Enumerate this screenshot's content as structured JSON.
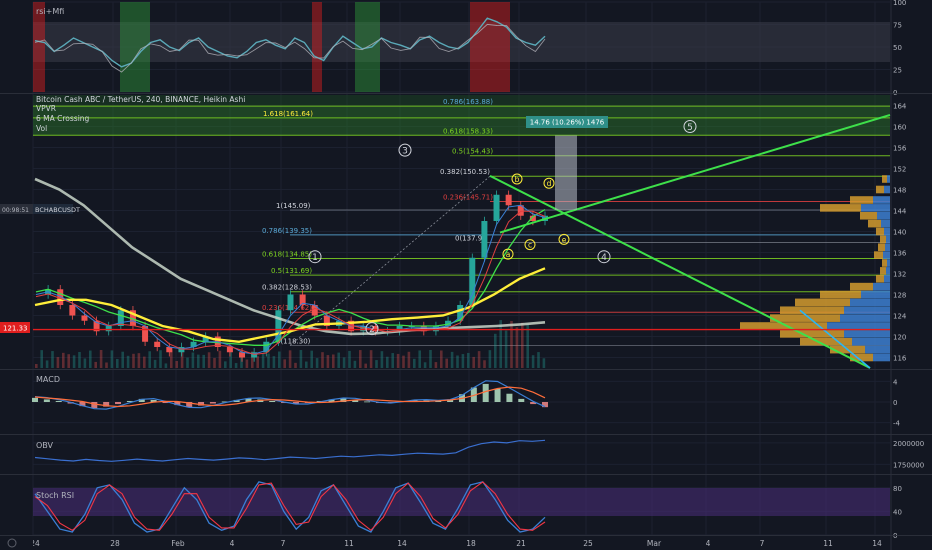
{
  "colors": {
    "bg": "#131722",
    "up": "#26a69a",
    "down": "#ef5350",
    "grid": "#1e2330",
    "axis_text": "#b2b5be",
    "yellow": "#ffee3a",
    "bright_green": "#3ee04a",
    "fib_green": "#7ed321",
    "ma_gray": "#c9d6c9",
    "macd_blue": "#3a7fd5",
    "macd_orange": "#ff6d3a",
    "stoch_purple": "#4a2d7a",
    "vpvr_orange": "#d39b2e",
    "vpvr_blue": "#3d7fd0",
    "price_red": "#e01e1e"
  },
  "panes": {
    "rsi": {
      "title": "rsi+Mfi",
      "ticks": [
        "100",
        "75",
        "50",
        "25",
        "0"
      ]
    },
    "main": {
      "title": "Bitcoin Cash ABC / TetherUS, 240, BINANCE, Heikin Ashi",
      "indicators": [
        "VPVR",
        "6 MA Crossing",
        "Vol"
      ],
      "ticks": [
        "164.00",
        "160.00",
        "156.00",
        "152.00",
        "148.00",
        "144.00",
        "140.00",
        "136.00",
        "132.00",
        "128.00",
        "124.00",
        "120.00",
        "116.00"
      ],
      "symbol_tag": "BCHABCUSDT",
      "current_price": "121.33",
      "small_price_tag": "00:98:51",
      "measure_label": "14.76 (10.26%) 1476"
    },
    "macd": {
      "title": "MACD",
      "ticks": [
        "4.0000",
        "0.0000",
        "-4.0000"
      ]
    },
    "obv": {
      "title": "OBV",
      "ticks": [
        "2000000.0000",
        "1750000.0000"
      ]
    },
    "stoch": {
      "title": "Stoch RSI",
      "ticks": [
        "80.0000",
        "40.0000",
        "0.0000"
      ]
    }
  },
  "time_axis": {
    "ticks": [
      "24",
      "28",
      "Feb",
      "4",
      "7",
      "11",
      "14",
      "18",
      "21",
      "25",
      "Mar",
      "4",
      "7",
      "11",
      "14"
    ]
  },
  "fib_levels": [
    {
      "label": "0.786(163.88)",
      "value": 163.88
    },
    {
      "label": "1.618(161.64)",
      "value": 161.64
    },
    {
      "label": "0.618(158.33)",
      "value": 158.33
    },
    {
      "label": "0.5(154.43)",
      "value": 154.43
    },
    {
      "label": "0.382(150.53)",
      "value": 150.53
    },
    {
      "label": "1(145.09)",
      "value": 145.09
    },
    {
      "label": "0.236(145.71)",
      "value": 145.71
    },
    {
      "label": "0.786(139.35)",
      "value": 139.35
    },
    {
      "label": "0(137.9)",
      "value": 137.9
    },
    {
      "label": "0.618(134.85)",
      "value": 134.85
    },
    {
      "label": "0.5(131.69)",
      "value": 131.69
    },
    {
      "label": "0.382(128.53)",
      "value": 128.53
    },
    {
      "label": "0.236(124.62)",
      "value": 124.62
    },
    {
      "label": "0(118.30)",
      "value": 118.3
    }
  ],
  "wave_labels": {
    "impulse": [
      "1",
      "2",
      "3",
      "4",
      "5"
    ],
    "correction": [
      "a",
      "b",
      "c",
      "d",
      "e"
    ]
  },
  "chart_data": [
    {
      "type": "line",
      "pane": "rsi+Mfi",
      "y_ticks": [
        100,
        75,
        50,
        25,
        0
      ],
      "ylim": [
        0,
        100
      ],
      "series": [
        {
          "values": [
            57,
            55,
            45,
            52,
            60,
            55,
            50,
            45,
            35,
            28,
            32,
            45,
            55,
            58,
            50,
            46,
            55,
            60,
            50,
            45,
            40,
            38,
            45,
            55,
            58,
            52,
            48,
            60,
            55,
            40,
            35,
            50,
            62,
            55,
            48,
            50,
            60,
            55,
            52,
            48,
            58,
            62,
            55,
            50,
            48,
            55,
            68,
            82,
            78,
            72,
            60,
            55,
            52,
            62
          ]
        }
      ]
    },
    {
      "type": "line",
      "pane": "price",
      "title": "Bitcoin Cash ABC / TetherUS, 240, BINANCE, Heikin Ashi",
      "y_ticks": [
        164,
        160,
        156,
        152,
        148,
        144,
        140,
        136,
        132,
        128,
        124,
        120,
        116
      ],
      "ylim": [
        114,
        166
      ],
      "x_ticks": [
        "24",
        "28",
        "Feb",
        "4",
        "7",
        "11",
        "14",
        "18",
        "21",
        "25",
        "Mar",
        "4",
        "7",
        "11",
        "14"
      ],
      "series": [
        {
          "values": [
            128,
            129,
            126,
            124,
            123,
            121,
            122,
            125,
            122,
            119,
            118,
            117,
            118,
            119,
            120,
            118,
            117,
            116,
            117,
            119,
            125,
            128,
            126,
            124,
            122,
            123,
            121,
            122,
            121,
            121,
            122,
            122,
            121,
            122,
            123,
            126,
            135,
            142,
            147,
            145,
            143,
            142,
            143
          ]
        }
      ]
    },
    {
      "type": "bar",
      "pane": "MACD",
      "y_ticks": [
        4,
        0,
        -4
      ],
      "ylim": [
        -6,
        6
      ],
      "values": [
        0.8,
        0.5,
        0.2,
        -0.3,
        -0.8,
        -1.2,
        -0.9,
        -0.4,
        0.2,
        0.6,
        0.4,
        -0.2,
        -0.6,
        -1.0,
        -0.7,
        -0.3,
        0.1,
        0.4,
        0.7,
        0.5,
        0.2,
        -0.2,
        -0.4,
        -0.2,
        0.2,
        0.5,
        0.7,
        0.4,
        0.1,
        -0.2,
        -0.1,
        0.2,
        0.4,
        0.3,
        0.2,
        0.5,
        1.5,
        2.8,
        3.5,
        2.6,
        1.6,
        0.6,
        -0.4,
        -1.0
      ]
    },
    {
      "type": "line",
      "pane": "OBV",
      "y_ticks": [
        2000000,
        1750000
      ],
      "ylim": [
        1650000,
        2080000
      ],
      "series": [
        {
          "values": [
            1830000,
            1815000,
            1800000,
            1790000,
            1808000,
            1795000,
            1786000,
            1798000,
            1812000,
            1800000,
            1790000,
            1805000,
            1818000,
            1808000,
            1800000,
            1812000,
            1825000,
            1818000,
            1805000,
            1818000,
            1835000,
            1828000,
            1818000,
            1832000,
            1845000,
            1838000,
            1850000,
            1862000,
            1855000,
            1868000,
            1880000,
            1875000,
            1870000,
            1885000,
            1950000,
            1990000,
            2010000,
            2000000,
            2025000,
            2018000,
            2030000
          ]
        }
      ]
    },
    {
      "type": "line",
      "pane": "Stoch RSI",
      "y_ticks": [
        80,
        40,
        0
      ],
      "ylim": [
        0,
        100
      ],
      "series": [
        {
          "values": [
            70,
            40,
            10,
            5,
            35,
            80,
            85,
            60,
            20,
            5,
            10,
            45,
            80,
            60,
            20,
            8,
            15,
            60,
            90,
            85,
            40,
            10,
            30,
            75,
            85,
            50,
            15,
            5,
            40,
            80,
            88,
            55,
            20,
            10,
            45,
            85,
            90,
            60,
            25,
            5,
            10,
            30
          ]
        },
        {
          "values": [
            65,
            50,
            20,
            8,
            25,
            70,
            85,
            70,
            30,
            10,
            8,
            35,
            70,
            70,
            30,
            12,
            12,
            45,
            85,
            88,
            50,
            18,
            22,
            65,
            85,
            60,
            25,
            8,
            30,
            70,
            88,
            65,
            28,
            12,
            35,
            75,
            90,
            70,
            35,
            10,
            8,
            22
          ]
        }
      ]
    }
  ]
}
